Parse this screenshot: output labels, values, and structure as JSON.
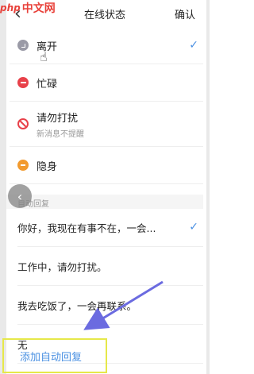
{
  "header": {
    "back_icon": "chevron-left-icon",
    "title": "在线状态",
    "confirm_label": "确认"
  },
  "watermark": {
    "php": "php",
    "text": "中文网"
  },
  "status_options": [
    {
      "label": "离开",
      "icon": "clock-icon",
      "color": "#9a9aa6",
      "selected": true
    },
    {
      "label": "忙碌",
      "icon": "minus-circle-icon",
      "color": "#e8414a",
      "selected": false
    },
    {
      "label": "请勿打扰",
      "sub": "新消息不提醒",
      "icon": "block-icon",
      "color": "#e8414a",
      "selected": false
    },
    {
      "label": "隐身",
      "icon": "hidden-icon",
      "color": "#f29a2e",
      "selected": false
    }
  ],
  "auto_reply": {
    "section_title": "自动回复",
    "items": [
      {
        "text": "你好，我现在有事不在，一会...",
        "selected": true
      },
      {
        "text": "工作中，请勿打扰。",
        "selected": false
      },
      {
        "text": "我去吃饭了，一会再联系。",
        "selected": false
      },
      {
        "text": "无",
        "selected": false
      }
    ],
    "add_label": "添加自动回复"
  },
  "colors": {
    "accent": "#4a90e2",
    "highlight": "#e6e84a",
    "annotation_arrow": "#6b6be0"
  }
}
